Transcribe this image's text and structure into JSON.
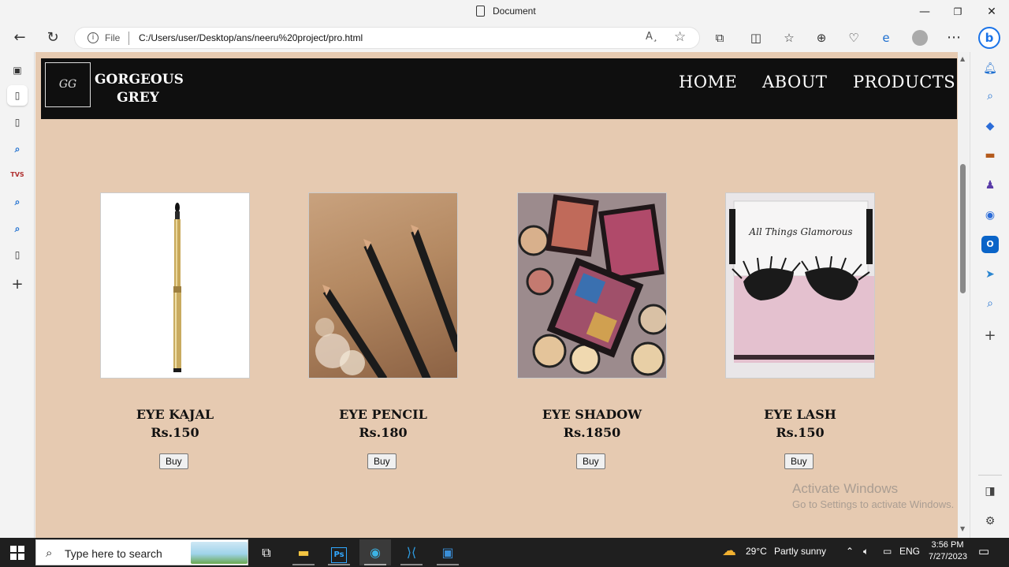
{
  "window": {
    "title": "Document",
    "controls": {
      "minimize": "—",
      "restore": "❐",
      "close": "✕"
    }
  },
  "browser": {
    "address_prefix": "File",
    "url": "C:/Users/user/Desktop/ans/neeru%20project/pro.html",
    "read_aloud": "A¸",
    "bing": "b"
  },
  "site": {
    "logo_text": "GG",
    "brand_line1": "GORGEOUS",
    "brand_line2": "GREY",
    "nav": [
      {
        "label": "HOME"
      },
      {
        "label": "ABOUT"
      },
      {
        "label": "PRODUCTS"
      }
    ],
    "products": [
      {
        "name": "EYE KAJAL",
        "price": "Rs.150",
        "buy_label": "Buy",
        "image": "gold-kajal-pen"
      },
      {
        "name": "EYE PENCIL",
        "price": "Rs.180",
        "buy_label": "Buy",
        "image": "black-eye-pencils"
      },
      {
        "name": "EYE SHADOW",
        "price": "Rs.1850",
        "buy_label": "Buy",
        "image": "eyeshadow-palettes"
      },
      {
        "name": "EYE LASH",
        "price": "Rs.150",
        "buy_label": "Buy",
        "image": "false-lashes-box",
        "box_text": "All Things Glamorous"
      }
    ]
  },
  "watermark": {
    "line1": "Activate Windows",
    "line2": "Go to Settings to activate Windows."
  },
  "taskbar": {
    "search_placeholder": "Type here to search",
    "weather_temp": "29°C",
    "weather_desc": "Partly sunny",
    "language": "ENG",
    "time": "3:56 PM",
    "date": "7/27/2023"
  },
  "colors": {
    "page_bg": "#e6cab1",
    "nav_bg": "#0f0f0f"
  }
}
